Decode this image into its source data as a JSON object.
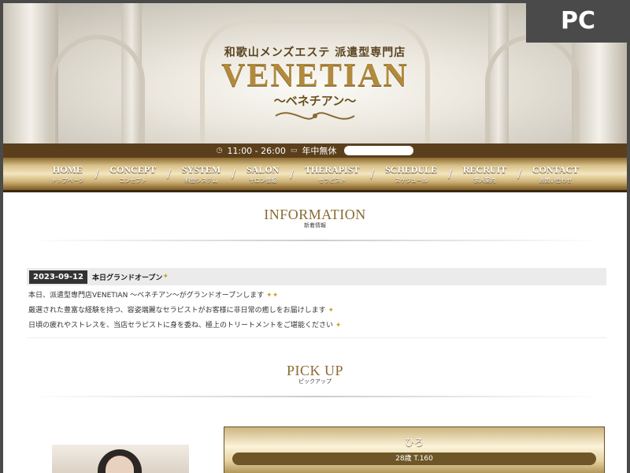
{
  "badge": {
    "label": "PC"
  },
  "header": {
    "subtitle": "和歌山メンズエステ 派遣型専門店",
    "title": "VENETIAN",
    "kana": "～ベネチアン～",
    "hours": "11:00 - 26:00",
    "holiday": "年中無休"
  },
  "nav": [
    {
      "en": "HOME",
      "ja": "トップページ"
    },
    {
      "en": "CONCEPT",
      "ja": "コンセプト"
    },
    {
      "en": "SYSTEM",
      "ja": "料金システム"
    },
    {
      "en": "SALON",
      "ja": "サロン情報"
    },
    {
      "en": "THERAPIST",
      "ja": "セラピスト"
    },
    {
      "en": "SCHEDULE",
      "ja": "スケジュール"
    },
    {
      "en": "RECRUIT",
      "ja": "求人案内"
    },
    {
      "en": "CONTACT",
      "ja": "お問い合わせ"
    }
  ],
  "information": {
    "heading_en": "INFORMATION",
    "heading_ja": "新着情報",
    "news": {
      "date": "2023-09-12",
      "title": "本日グランドオープン",
      "lines": [
        "本日、派遣型専門店VENETIAN ～ベネチアン～がグランドオープンします",
        "厳選された豊富な経験を持つ、容姿端麗なセラピストがお客様に非日常の癒しをお届けします",
        "日頃の疲れやストレスを、当店セラピストに身を委ね、極上のトリートメントをご堪能ください"
      ]
    }
  },
  "pickup": {
    "heading_en": "PICK UP",
    "heading_ja": "ピックアップ",
    "therapist_name": "ひろ",
    "therapist_info": "28歳 T.160"
  },
  "colors": {
    "gold": "#b28a3c",
    "brown": "#5b3f1c",
    "accent_text": "#8a6a32"
  }
}
